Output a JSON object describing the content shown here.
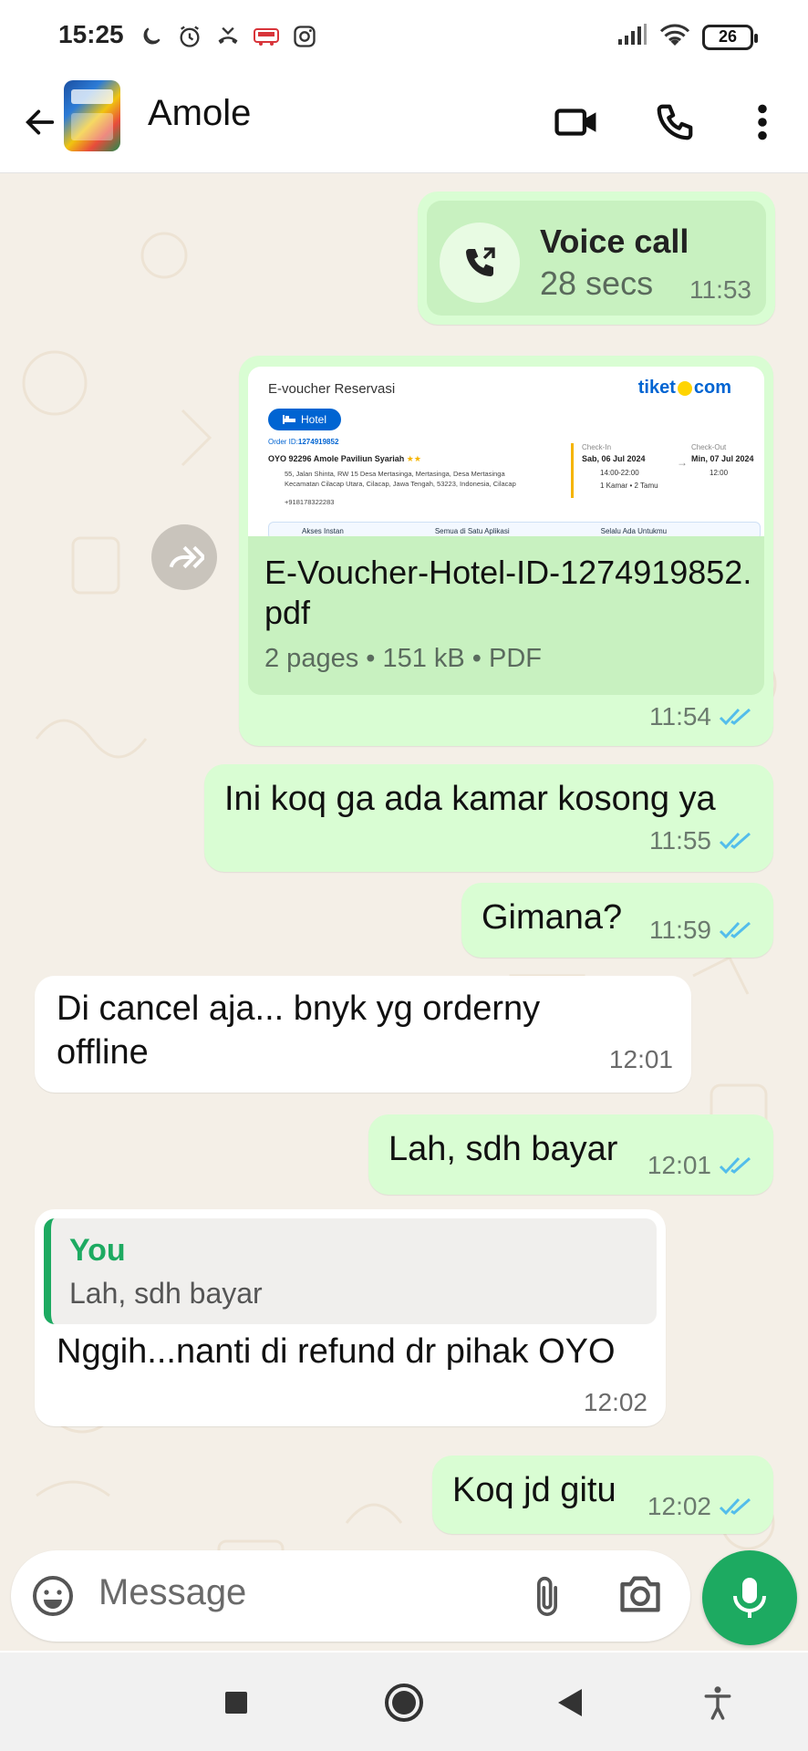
{
  "status_bar": {
    "time": "15:25",
    "battery": "26"
  },
  "header": {
    "contact_name": "Amole"
  },
  "messages": {
    "voice_call": {
      "title": "Voice call",
      "duration": "28 secs",
      "time": "11:53"
    },
    "document": {
      "preview": {
        "title": "E-voucher Reservasi",
        "brand": "tiket",
        "brand_suffix": "com",
        "category": "Hotel",
        "order_label": "Order ID:",
        "order_id": "1274919852",
        "hotel_name": "OYO 92296 Amole Paviliun Syariah",
        "address_line1": "55, Jalan Shinta, RW 15 Desa Mertasinga, Mertasinga, Desa Mertasinga",
        "address_line2": "Kecamatan Cilacap Utara, Cilacap, Jawa Tengah, 53223, Indonesia, Cilacap",
        "phone": "+918178322283",
        "checkin_label": "Check-In",
        "checkin_date": "Sab, 06 Jul 2024",
        "checkin_time": "14:00-22:00",
        "checkout_label": "Check-Out",
        "checkout_date": "Min, 07 Jul 2024",
        "checkout_time": "12:00",
        "rooms": "1 Kamar • 2 Tamu",
        "footer_1": "Akses Instan",
        "footer_2": "Semua di Satu Aplikasi",
        "footer_3": "Selalu Ada Untukmu"
      },
      "filename": "E-Voucher-Hotel-ID-1274919852.pdf",
      "details": "2 pages • 151 kB • PDF",
      "time": "11:54"
    },
    "msg1": {
      "text": "Ini koq ga ada kamar kosong ya",
      "time": "11:55"
    },
    "msg2": {
      "text": "Gimana?",
      "time": "11:59"
    },
    "msg3": {
      "text": "Di cancel aja... bnyk yg orderny offline",
      "time": "12:01"
    },
    "msg4": {
      "text": "Lah, sdh bayar",
      "time": "12:01"
    },
    "msg5": {
      "quote_author": "You",
      "quote_text": "Lah, sdh bayar",
      "text": "Nggih...nanti di refund dr pihak OYO",
      "time": "12:02"
    },
    "msg6": {
      "text": "Koq jd gitu",
      "time": "12:02"
    }
  },
  "input": {
    "placeholder": "Message"
  },
  "colors": {
    "outgoing": "#d9fdd3",
    "incoming": "#ffffff",
    "accent": "#1daa61",
    "ticks": "#53bdeb",
    "chat_bg": "#f4efe7"
  }
}
